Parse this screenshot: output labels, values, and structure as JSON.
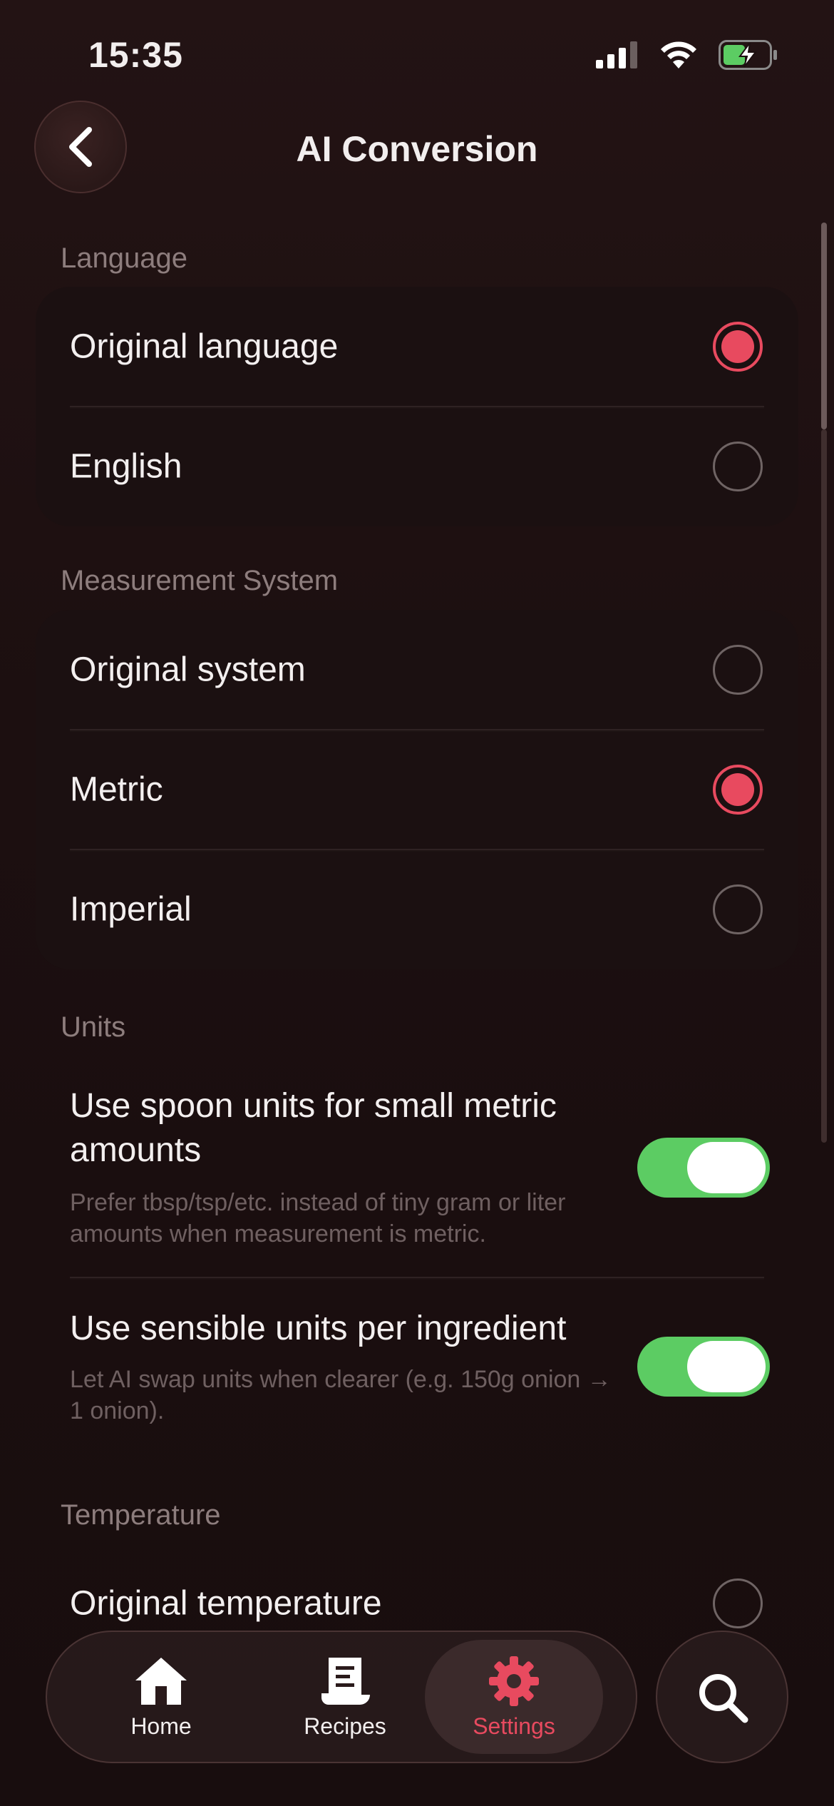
{
  "status": {
    "time": "15:35"
  },
  "nav": {
    "title": "AI Conversion"
  },
  "language": {
    "label": "Language",
    "options": [
      {
        "label": "Original language",
        "selected": true
      },
      {
        "label": "English",
        "selected": false
      }
    ]
  },
  "measurement": {
    "label": "Measurement System",
    "options": [
      {
        "label": "Original system",
        "selected": false
      },
      {
        "label": "Metric",
        "selected": true
      },
      {
        "label": "Imperial",
        "selected": false
      }
    ]
  },
  "units": {
    "label": "Units",
    "toggles": [
      {
        "title": "Use spoon units for small metric amounts",
        "subtitle": "Prefer tbsp/tsp/etc. instead of tiny gram or liter amounts when measurement is metric.",
        "on": true
      },
      {
        "title": "Use sensible units per ingredient",
        "subtitle": "Let AI swap units when clearer (e.g. 150g onion → 1 onion).",
        "on": true
      }
    ]
  },
  "temperature": {
    "label": "Temperature",
    "options": [
      {
        "label": "Original temperature",
        "selected": false
      }
    ]
  },
  "tabbar": {
    "tabs": [
      {
        "label": "Home",
        "icon": "home-icon"
      },
      {
        "label": "Recipes",
        "icon": "recipes-icon"
      },
      {
        "label": "Settings",
        "icon": "gear-icon",
        "active": true
      }
    ],
    "search_icon": "search-icon"
  },
  "colors": {
    "accent": "#e84a5f",
    "toggle_on": "#5ccc63",
    "background": "#1c0f10"
  }
}
